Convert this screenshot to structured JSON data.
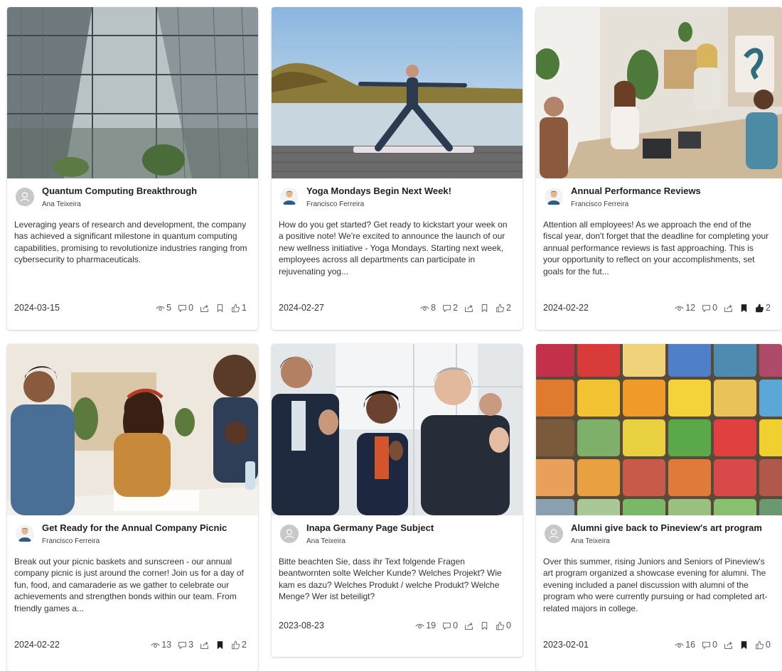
{
  "cards": [
    {
      "title": "Quantum Computing Breakthrough",
      "author": "Ana Teixeira",
      "avatar": "generic-user-icon",
      "excerpt": "Leveraging years of research and development, the company has achieved a significant milestone in quantum computing capabilities, promising to revolutionize industries ranging from cybersecurity to pharmaceuticals.",
      "date": "2024-03-15",
      "views": "5",
      "comments": "0",
      "likes": "1",
      "bookmarked": false,
      "liked": false,
      "image": "modern-office-atrium"
    },
    {
      "title": "Yoga Mondays Begin Next Week!",
      "author": "Francisco Ferreira",
      "avatar": "person-avatar-icon",
      "excerpt": "How do you get started? Get ready to kickstart your week on a positive note! We're excited to announce the launch of our new wellness initiative - Yoga Mondays. Starting next week, employees across all departments can participate in rejuvenating yog...",
      "date": "2024-02-27",
      "views": "8",
      "comments": "2",
      "likes": "2",
      "bookmarked": false,
      "liked": false,
      "image": "yoga-by-lake"
    },
    {
      "title": "Annual Performance Reviews",
      "author": "Francisco Ferreira",
      "avatar": "person-avatar-icon",
      "excerpt": "Attention all employees! As we approach the end of the fiscal year, don't forget that the deadline for completing your annual performance reviews is fast approaching. This is your opportunity to reflect on your accomplishments, set goals for the fut...",
      "date": "2024-02-22",
      "views": "12",
      "comments": "0",
      "likes": "2",
      "bookmarked": true,
      "liked": true,
      "image": "team-meeting"
    },
    {
      "title": "Get Ready for the Annual Company Picnic",
      "author": "Francisco Ferreira",
      "avatar": "person-avatar-icon",
      "excerpt": "Break out your picnic baskets and sunscreen - our annual company picnic is just around the corner! Join us for a day of fun, food, and camaraderie as we gather to celebrate our achievements and strengthen bonds within our team. From friendly games a...",
      "date": "2024-02-22",
      "views": "13",
      "comments": "3",
      "likes": "2",
      "bookmarked": true,
      "liked": false,
      "image": "colleagues-laughing"
    },
    {
      "title": "Inapa Germany Page Subject",
      "author": "Ana Teixeira",
      "avatar": "generic-user-icon",
      "excerpt": "Bitte beachten Sie, dass ihr Text folgende Fragen beantwornten solte Welcher Kunde? Welches Projekt? Wie kam es dazu? Welches Produkt / welche Produkt? Welche Menge? Wer ist beteiligt?",
      "date": "2023-08-23",
      "views": "19",
      "comments": "0",
      "likes": "0",
      "bookmarked": false,
      "liked": false,
      "image": "people-applauding"
    },
    {
      "title": "Alumni give back to Pineview's art program",
      "author": "Ana Teixeira",
      "avatar": "generic-user-icon",
      "excerpt": "Over this summer, rising Juniors and Seniors of Pineview's art program organized a showcase evening for alumni. The evening included a panel discussion with alumni of the program who were currently pursuing or had completed art-related majors in college.",
      "date": "2023-02-01",
      "views": "16",
      "comments": "0",
      "likes": "0",
      "bookmarked": true,
      "liked": false,
      "image": "pastel-chalk-grid"
    }
  ],
  "colors": {
    "bookmark_active": "#1f1f1f",
    "like_active": "#1f1f1f",
    "icon_default": "#616161"
  }
}
